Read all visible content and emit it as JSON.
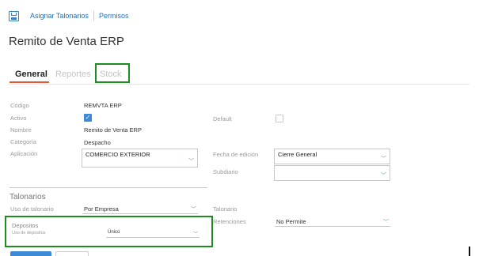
{
  "toolbar": {
    "assign_label": "Asignar Talonarios",
    "permissions_label": "Permisos"
  },
  "page_title": "Remito de Venta ERP",
  "tabs": [
    {
      "label": "General",
      "active": true
    },
    {
      "label": "Reportes",
      "active": false
    },
    {
      "label": "Stock",
      "active": false
    }
  ],
  "form": {
    "codigo": {
      "label": "Código",
      "value": "REMVTA ERP"
    },
    "activo": {
      "label": "Activo",
      "checked": true
    },
    "default": {
      "label": "Default",
      "checked": false
    },
    "nombre": {
      "label": "Nombre",
      "value": "Remito de Venta ERP"
    },
    "categoria": {
      "label": "Categoría",
      "value": "Despacho"
    },
    "aplicacion": {
      "label": "Aplicación",
      "value": "COMERCIO EXTERIOR"
    },
    "fecha_edicion": {
      "label": "Fecha de edición",
      "value": "Cierre General"
    },
    "subdiario": {
      "label": "Subdiario",
      "value": ""
    }
  },
  "talonarios": {
    "section_title": "Talonarios",
    "uso": {
      "label": "Uso de talonario",
      "value": "Por Empresa"
    },
    "talonario": {
      "label": "Talonario",
      "value": ""
    },
    "retenciones": {
      "label": "Retenciones",
      "value": "No Permite"
    },
    "depositos": {
      "title": "Depositos",
      "label": "Uso de depositos",
      "value": "Único"
    }
  },
  "colors": {
    "accent": "#3d8ad6",
    "highlight": "#1f8c1f",
    "tab_underline": "#e05a38"
  }
}
